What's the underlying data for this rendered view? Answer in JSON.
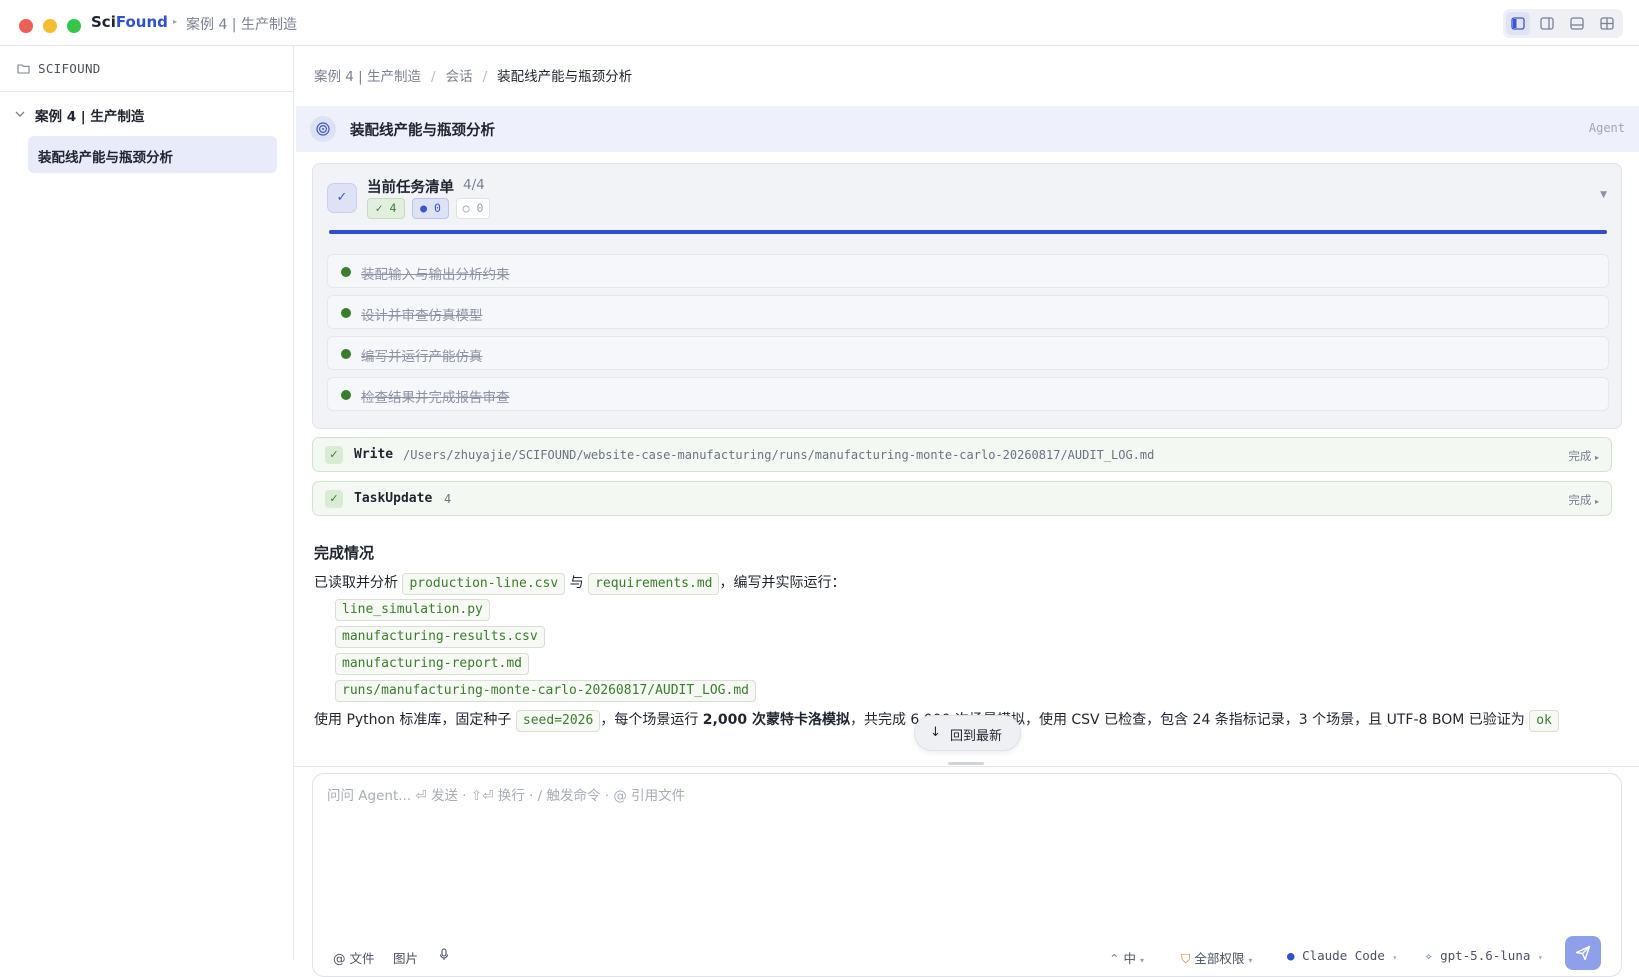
{
  "window": {
    "brand_prefix": "Sci",
    "brand_suffix": "Found",
    "project_title": "案例 4 | 生产制造"
  },
  "sidebar": {
    "workspace": "SCIFOUND",
    "tree": {
      "node_label": "案例 4 | 生产制造",
      "leaf_label": "装配线产能与瓶颈分析"
    }
  },
  "breadcrumb": [
    "案例 4 | 生产制造",
    "会话",
    "装配线产能与瓶颈分析"
  ],
  "session": {
    "title": "装配线产能与瓶颈分析",
    "agent_label": "Agent"
  },
  "task_list": {
    "title": "当前任务清单",
    "count": "4/4",
    "completed": "✓ 4",
    "in_progress": "● 0",
    "pending": "○ 0",
    "progress_fraction": 1.0,
    "items": [
      "装配输入与输出分析约束",
      "设计并审查仿真模型",
      "编写并运行产能仿真",
      "检查结果并完成报告审查"
    ]
  },
  "tool_calls": [
    {
      "name": "Write",
      "arg": "/Users/zhuyajie/SCIFOUND/website-case-manufacturing/runs/manufacturing-monte-carlo-20260817/AUDIT_LOG.md",
      "status": "完成"
    },
    {
      "name": "TaskUpdate",
      "arg": "4",
      "status": "完成"
    }
  ],
  "summary": {
    "title": "完成情况",
    "line_prefix": "已读取并分析",
    "file1": "production-line.csv",
    "conj": "与",
    "file2": "requirements.md",
    "line_suffix": "，编写并实际运行：",
    "outputs": [
      "line_simulation.py",
      "manufacturing-results.csv",
      "manufacturing-report.md",
      "runs/manufacturing-monte-carlo-20260817/AUDIT_LOG.md"
    ],
    "cut_part1": "使用 Python 标准库，固定种子",
    "cut_code1": "seed=2026",
    "cut_part2": "，每个场景运行",
    "cut_bold": "2,000 次蒙特卡洛模拟",
    "cut_part3": "，共完成 6,000 次场景模拟，使用 CSV 已检查，包含 24 条指标记录，3 个场景，且 UTF-8 BOM 已验证为",
    "cut_code2": "ok"
  },
  "scroll_to_latest": "回到最新",
  "composer": {
    "placeholder": "问问 Agent... ⏎ 发送 · ⇧⏎ 换行 · / 触发命令 · @ 引用文件",
    "file_btn": "@ 文件",
    "image_btn": "图片",
    "effort": "中",
    "permission": "全部权限",
    "engine": "Claude Code",
    "model": "gpt-5.6-luna"
  },
  "colors": {
    "accent": "#2f4fd6",
    "success": "#3a7d2c",
    "send": "#8fa0ea"
  }
}
